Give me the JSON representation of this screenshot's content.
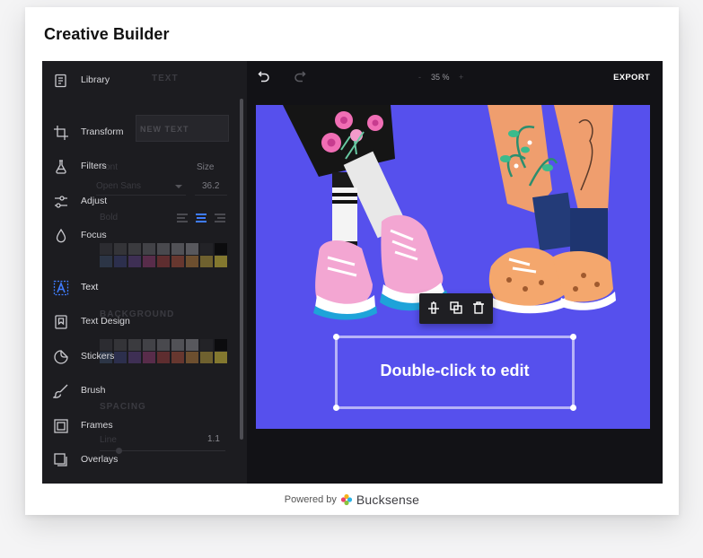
{
  "page": {
    "title": "Creative Builder"
  },
  "sidebar": {
    "items": [
      {
        "label": "Library",
        "icon": "library-icon"
      },
      {
        "label": "Transform",
        "icon": "crop-icon"
      },
      {
        "label": "Filters",
        "icon": "flask-icon"
      },
      {
        "label": "Adjust",
        "icon": "sliders-icon"
      },
      {
        "label": "Focus",
        "icon": "drop-icon"
      },
      {
        "label": "Text",
        "icon": "text-icon",
        "active": true
      },
      {
        "label": "Text Design",
        "icon": "bookmark-icon"
      },
      {
        "label": "Stickers",
        "icon": "sticker-icon"
      },
      {
        "label": "Brush",
        "icon": "brush-icon"
      },
      {
        "label": "Frames",
        "icon": "frame-icon"
      },
      {
        "label": "Overlays",
        "icon": "overlay-icon"
      }
    ],
    "text_panel": {
      "title": "TEXT",
      "new_text_button": "NEW TEXT",
      "font_label": "Font",
      "size_label": "Size",
      "font_value": "Open Sans",
      "size_value": "36.2",
      "weight_value": "Bold",
      "background_label": "BACKGROUND",
      "spacing_label": "SPACING",
      "line_label": "Line",
      "line_value": "1.1"
    }
  },
  "colors": {
    "accent": "#3f7cff",
    "canvas_background": "#5650ed",
    "palette_row1": [
      "#3b3b40",
      "#48484d",
      "#55555a",
      "#636368",
      "#707075",
      "#7e7e83",
      "#8b8b90",
      "#2a2a2e",
      "#000000"
    ],
    "palette_row2": [
      "#3b4a66",
      "#3b3f73",
      "#5b3f80",
      "#8a3a6e",
      "#963c3c",
      "#a64f3c",
      "#b07a3c",
      "#b59a3c",
      "#d8c43c"
    ]
  },
  "toolbar": {
    "undo_icon": "undo-icon",
    "redo_icon": "redo-icon",
    "zoom_label": "35 %",
    "zoom_minus": "-",
    "zoom_plus": "+",
    "export_label": "EXPORT"
  },
  "canvas": {
    "placeholder_text": "Double-click to edit",
    "context_actions": [
      "align-icon",
      "duplicate-icon",
      "trash-icon"
    ]
  },
  "footer": {
    "powered_by": "Powered by",
    "brand": "Bucksense"
  }
}
